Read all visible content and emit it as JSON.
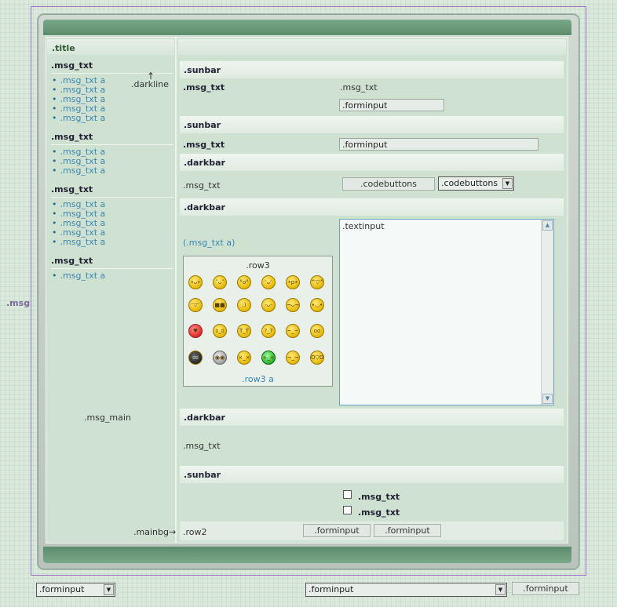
{
  "labels": {
    "msg": ".msg",
    "title": ".title",
    "darkline": ".darkline",
    "msg_main": ".msg_main",
    "mainbg": ".mainbg→",
    "row2": ".row2",
    "row3": ".row3",
    "row3a": ".row3 a"
  },
  "sidebar": {
    "groups": [
      {
        "head": ".msg_txt",
        "items": [
          ".msg_txt a",
          ".msg_txt a",
          ".msg_txt a",
          ".msg_txt a",
          ".msg_txt a"
        ]
      },
      {
        "head": ".msg_txt",
        "items": [
          ".msg_txt a",
          ".msg_txt a",
          ".msg_txt a"
        ]
      },
      {
        "head": ".msg_txt",
        "items": [
          ".msg_txt a",
          ".msg_txt a",
          ".msg_txt a",
          ".msg_txt a",
          ".msg_txt a"
        ]
      },
      {
        "head": ".msg_txt",
        "items": [
          ".msg_txt a"
        ]
      }
    ]
  },
  "main": {
    "sunbar": ".sunbar",
    "darkbar": ".darkbar",
    "msg_txt": ".msg_txt",
    "msg_txt_link": "(.msg_txt a)",
    "forminput": ".forminput",
    "codebuttons": ".codebuttons",
    "textinput": ".textinput"
  },
  "bottom": {
    "select_small": ".forminput",
    "select_wide": ".forminput",
    "button": ".forminput"
  },
  "icons": {
    "smileys": [
      "smile-icon",
      "grin-icon",
      "shock-icon",
      "happy-icon",
      "tongue-icon",
      "laugh-icon",
      "biggrin-icon",
      "cool-icon",
      "wink-icon",
      "sleepy-icon",
      "smirk-icon",
      "smile2-icon",
      "love-icon",
      "angry-icon",
      "cry-icon",
      "confused-icon",
      "worried-icon",
      "glasses-icon",
      "ninja-icon",
      "alien-icon",
      "sick-icon",
      "green-icon",
      "sneaky-icon",
      "yell-icon"
    ]
  }
}
